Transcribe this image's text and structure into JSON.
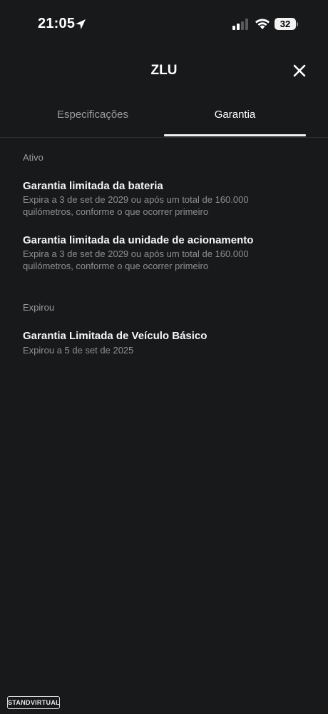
{
  "status_bar": {
    "time": "21:05",
    "battery": "32",
    "icons": [
      "location-arrow-icon",
      "cellular-signal-icon",
      "wifi-icon",
      "battery-icon"
    ]
  },
  "header": {
    "title": "ZLU",
    "close_icon": "close-icon"
  },
  "tabs": [
    {
      "label": "Especificações",
      "active": false
    },
    {
      "label": "Garantia",
      "active": true
    }
  ],
  "sections": {
    "active": {
      "label": "Ativo",
      "items": [
        {
          "title": "Garantia limitada da bateria",
          "desc_line1": "Expira a 3 de set de 2029 ou após um total de 160.000",
          "desc_line2": "quilómetros, conforme o que ocorrer primeiro"
        },
        {
          "title": "Garantia limitada da unidade de acionamento",
          "desc_line1": "Expira a 3 de set de 2029 ou após um total de 160.000",
          "desc_line2": "quilómetros, conforme o que ocorrer primeiro"
        }
      ]
    },
    "expired": {
      "label": "Expirou",
      "items": [
        {
          "title": "Garantia Limitada de Veículo Básico",
          "desc_line1": "Expirou a 5 de set de 2025"
        }
      ]
    }
  },
  "watermark": "STANDVIRTUAL",
  "colors": {
    "background": "#18191b",
    "text_primary": "#ffffff",
    "text_secondary": "#9a9b9e",
    "divider": "#2e2f32"
  }
}
